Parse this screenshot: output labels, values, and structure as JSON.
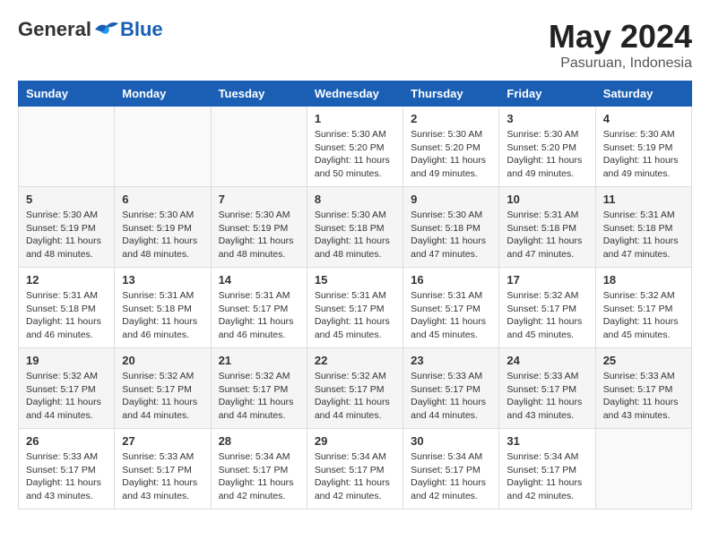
{
  "header": {
    "logo_general": "General",
    "logo_blue": "Blue",
    "month_year": "May 2024",
    "location": "Pasuruan, Indonesia"
  },
  "weekdays": [
    "Sunday",
    "Monday",
    "Tuesday",
    "Wednesday",
    "Thursday",
    "Friday",
    "Saturday"
  ],
  "weeks": [
    [
      {
        "day": "",
        "info": ""
      },
      {
        "day": "",
        "info": ""
      },
      {
        "day": "",
        "info": ""
      },
      {
        "day": "1",
        "info": "Sunrise: 5:30 AM\nSunset: 5:20 PM\nDaylight: 11 hours\nand 50 minutes."
      },
      {
        "day": "2",
        "info": "Sunrise: 5:30 AM\nSunset: 5:20 PM\nDaylight: 11 hours\nand 49 minutes."
      },
      {
        "day": "3",
        "info": "Sunrise: 5:30 AM\nSunset: 5:20 PM\nDaylight: 11 hours\nand 49 minutes."
      },
      {
        "day": "4",
        "info": "Sunrise: 5:30 AM\nSunset: 5:19 PM\nDaylight: 11 hours\nand 49 minutes."
      }
    ],
    [
      {
        "day": "5",
        "info": "Sunrise: 5:30 AM\nSunset: 5:19 PM\nDaylight: 11 hours\nand 48 minutes."
      },
      {
        "day": "6",
        "info": "Sunrise: 5:30 AM\nSunset: 5:19 PM\nDaylight: 11 hours\nand 48 minutes."
      },
      {
        "day": "7",
        "info": "Sunrise: 5:30 AM\nSunset: 5:19 PM\nDaylight: 11 hours\nand 48 minutes."
      },
      {
        "day": "8",
        "info": "Sunrise: 5:30 AM\nSunset: 5:18 PM\nDaylight: 11 hours\nand 48 minutes."
      },
      {
        "day": "9",
        "info": "Sunrise: 5:30 AM\nSunset: 5:18 PM\nDaylight: 11 hours\nand 47 minutes."
      },
      {
        "day": "10",
        "info": "Sunrise: 5:31 AM\nSunset: 5:18 PM\nDaylight: 11 hours\nand 47 minutes."
      },
      {
        "day": "11",
        "info": "Sunrise: 5:31 AM\nSunset: 5:18 PM\nDaylight: 11 hours\nand 47 minutes."
      }
    ],
    [
      {
        "day": "12",
        "info": "Sunrise: 5:31 AM\nSunset: 5:18 PM\nDaylight: 11 hours\nand 46 minutes."
      },
      {
        "day": "13",
        "info": "Sunrise: 5:31 AM\nSunset: 5:18 PM\nDaylight: 11 hours\nand 46 minutes."
      },
      {
        "day": "14",
        "info": "Sunrise: 5:31 AM\nSunset: 5:17 PM\nDaylight: 11 hours\nand 46 minutes."
      },
      {
        "day": "15",
        "info": "Sunrise: 5:31 AM\nSunset: 5:17 PM\nDaylight: 11 hours\nand 45 minutes."
      },
      {
        "day": "16",
        "info": "Sunrise: 5:31 AM\nSunset: 5:17 PM\nDaylight: 11 hours\nand 45 minutes."
      },
      {
        "day": "17",
        "info": "Sunrise: 5:32 AM\nSunset: 5:17 PM\nDaylight: 11 hours\nand 45 minutes."
      },
      {
        "day": "18",
        "info": "Sunrise: 5:32 AM\nSunset: 5:17 PM\nDaylight: 11 hours\nand 45 minutes."
      }
    ],
    [
      {
        "day": "19",
        "info": "Sunrise: 5:32 AM\nSunset: 5:17 PM\nDaylight: 11 hours\nand 44 minutes."
      },
      {
        "day": "20",
        "info": "Sunrise: 5:32 AM\nSunset: 5:17 PM\nDaylight: 11 hours\nand 44 minutes."
      },
      {
        "day": "21",
        "info": "Sunrise: 5:32 AM\nSunset: 5:17 PM\nDaylight: 11 hours\nand 44 minutes."
      },
      {
        "day": "22",
        "info": "Sunrise: 5:32 AM\nSunset: 5:17 PM\nDaylight: 11 hours\nand 44 minutes."
      },
      {
        "day": "23",
        "info": "Sunrise: 5:33 AM\nSunset: 5:17 PM\nDaylight: 11 hours\nand 44 minutes."
      },
      {
        "day": "24",
        "info": "Sunrise: 5:33 AM\nSunset: 5:17 PM\nDaylight: 11 hours\nand 43 minutes."
      },
      {
        "day": "25",
        "info": "Sunrise: 5:33 AM\nSunset: 5:17 PM\nDaylight: 11 hours\nand 43 minutes."
      }
    ],
    [
      {
        "day": "26",
        "info": "Sunrise: 5:33 AM\nSunset: 5:17 PM\nDaylight: 11 hours\nand 43 minutes."
      },
      {
        "day": "27",
        "info": "Sunrise: 5:33 AM\nSunset: 5:17 PM\nDaylight: 11 hours\nand 43 minutes."
      },
      {
        "day": "28",
        "info": "Sunrise: 5:34 AM\nSunset: 5:17 PM\nDaylight: 11 hours\nand 42 minutes."
      },
      {
        "day": "29",
        "info": "Sunrise: 5:34 AM\nSunset: 5:17 PM\nDaylight: 11 hours\nand 42 minutes."
      },
      {
        "day": "30",
        "info": "Sunrise: 5:34 AM\nSunset: 5:17 PM\nDaylight: 11 hours\nand 42 minutes."
      },
      {
        "day": "31",
        "info": "Sunrise: 5:34 AM\nSunset: 5:17 PM\nDaylight: 11 hours\nand 42 minutes."
      },
      {
        "day": "",
        "info": ""
      }
    ]
  ]
}
